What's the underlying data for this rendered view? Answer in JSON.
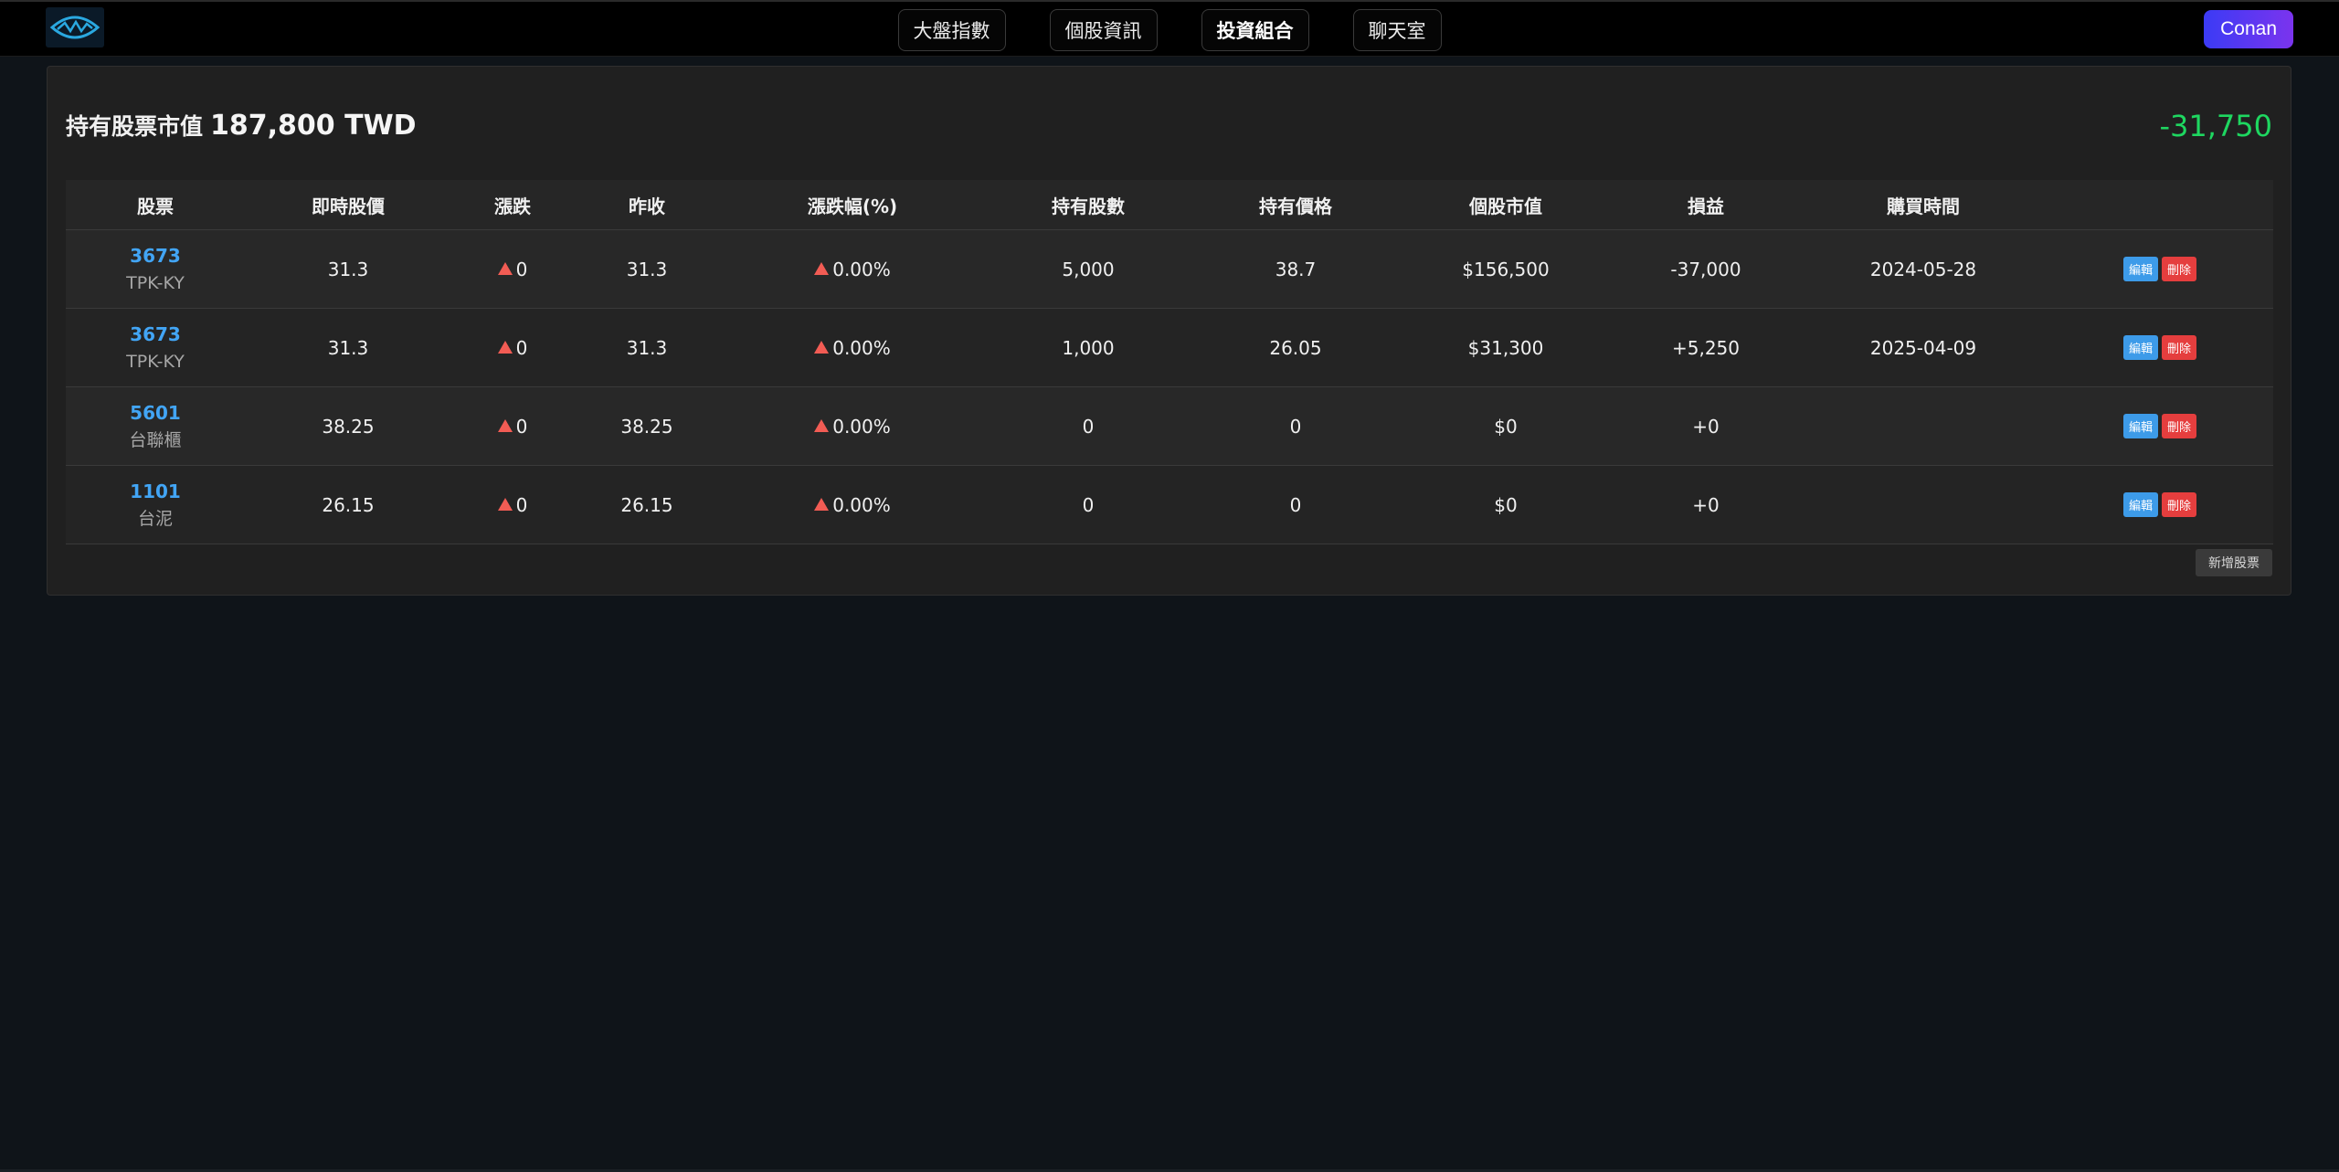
{
  "nav": {
    "tabs": [
      {
        "label": "大盤指數"
      },
      {
        "label": "個股資訊"
      },
      {
        "label": "投資組合",
        "active": true
      },
      {
        "label": "聊天室"
      }
    ],
    "user": "Conan"
  },
  "summary": {
    "label": "持有股票市值",
    "value": "187,800 TWD",
    "pnl": "-31,750"
  },
  "table": {
    "headers": [
      "股票",
      "即時股價",
      "漲跌",
      "昨收",
      "漲跌幅(%)",
      "持有股數",
      "持有價格",
      "個股市值",
      "損益",
      "購買時間",
      ""
    ],
    "rows": [
      {
        "code": "3673",
        "name": "TPK-KY",
        "price": "31.3",
        "change": "0",
        "prev_close": "31.3",
        "change_pct": "0.00%",
        "shares": "5,000",
        "cost": "38.7",
        "market_value": "$156,500",
        "pnl": "-37,000",
        "pnl_dir": "down",
        "buy_date": "2024-05-28"
      },
      {
        "code": "3673",
        "name": "TPK-KY",
        "price": "31.3",
        "change": "0",
        "prev_close": "31.3",
        "change_pct": "0.00%",
        "shares": "1,000",
        "cost": "26.05",
        "market_value": "$31,300",
        "pnl": "+5,250",
        "pnl_dir": "up",
        "buy_date": "2025-04-09"
      },
      {
        "code": "5601",
        "name": "台聯櫃",
        "price": "38.25",
        "change": "0",
        "prev_close": "38.25",
        "change_pct": "0.00%",
        "shares": "0",
        "cost": "0",
        "market_value": "$0",
        "pnl": "+0",
        "pnl_dir": "up",
        "buy_date": ""
      },
      {
        "code": "1101",
        "name": "台泥",
        "price": "26.15",
        "change": "0",
        "prev_close": "26.15",
        "change_pct": "0.00%",
        "shares": "0",
        "cost": "0",
        "market_value": "$0",
        "pnl": "+0",
        "pnl_dir": "up",
        "buy_date": ""
      }
    ],
    "edit_label": "編輯",
    "delete_label": "刪除"
  },
  "add_stock_label": "新增股票",
  "colors": {
    "up": "#f25c54",
    "down": "#1ed760",
    "link": "#42a5f5",
    "accent_start": "#3b3bf5",
    "accent_end": "#7b34ee"
  },
  "icons": {
    "logo": "eye-wave-logo-icon",
    "change": "triangle-up-icon"
  }
}
